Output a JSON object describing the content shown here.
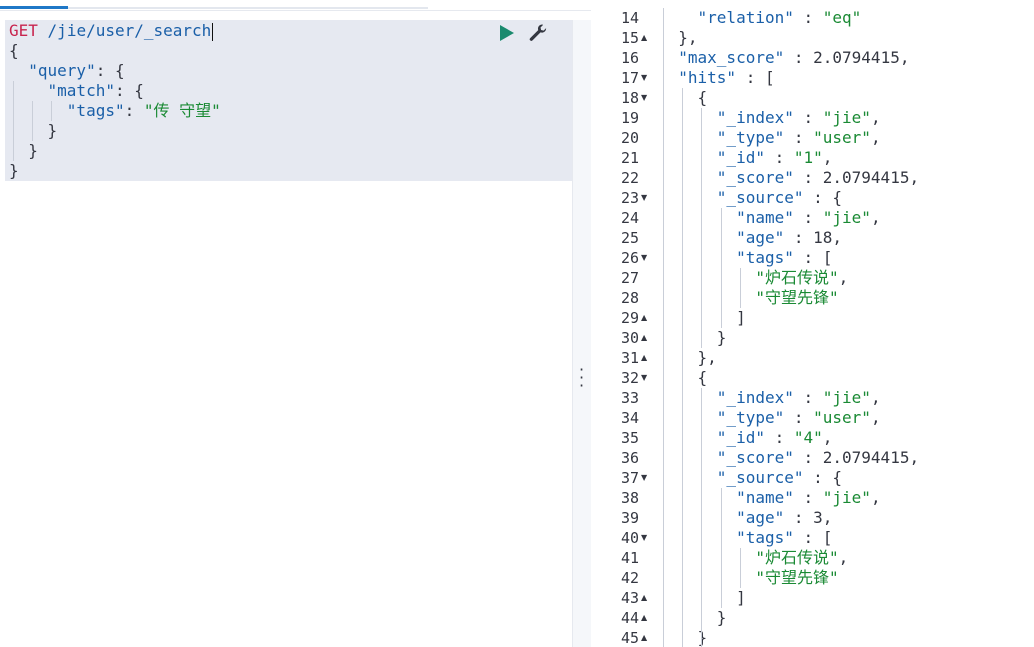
{
  "request": {
    "method": "GET",
    "path": "/jie/user/_search",
    "body_lines": [
      {
        "indent": 0,
        "parts": [
          {
            "t": "{",
            "c": "punct"
          }
        ]
      },
      {
        "indent": 1,
        "parts": [
          {
            "t": "\"query\"",
            "c": "key"
          },
          {
            "t": ": {",
            "c": "punct"
          }
        ]
      },
      {
        "indent": 2,
        "parts": [
          {
            "t": "\"match\"",
            "c": "key"
          },
          {
            "t": ": {",
            "c": "punct"
          }
        ]
      },
      {
        "indent": 3,
        "parts": [
          {
            "t": "\"tags\"",
            "c": "key"
          },
          {
            "t": ": ",
            "c": "punct"
          },
          {
            "t": "\"传 守望\"",
            "c": "str"
          }
        ]
      },
      {
        "indent": 2,
        "parts": [
          {
            "t": "}",
            "c": "punct"
          }
        ]
      },
      {
        "indent": 1,
        "parts": [
          {
            "t": "}",
            "c": "punct"
          }
        ]
      },
      {
        "indent": 0,
        "parts": [
          {
            "t": "}",
            "c": "punct"
          }
        ]
      }
    ]
  },
  "icons": {
    "run": "play-triangle-icon",
    "settings": "wrench-icon",
    "divider": "vertical-ellipsis-icon"
  },
  "colors": {
    "method": "#c8244e",
    "key": "#1a5fa8",
    "string": "#1a8a34",
    "run": "#1a8a6e",
    "tab_active": "#1f78c7"
  },
  "response": {
    "lines": [
      {
        "n": "14",
        "fold": "",
        "indent": 2,
        "parts": [
          {
            "t": "\"relation\"",
            "c": "key"
          },
          {
            "t": " : ",
            "c": "punct"
          },
          {
            "t": "\"eq\"",
            "c": "str"
          }
        ]
      },
      {
        "n": "15",
        "fold": "▲",
        "indent": 1,
        "parts": [
          {
            "t": "},",
            "c": "punct"
          }
        ]
      },
      {
        "n": "16",
        "fold": "",
        "indent": 1,
        "parts": [
          {
            "t": "\"max_score\"",
            "c": "key"
          },
          {
            "t": " : 2.0794415,",
            "c": "punct"
          }
        ]
      },
      {
        "n": "17",
        "fold": "▼",
        "indent": 1,
        "parts": [
          {
            "t": "\"hits\"",
            "c": "key"
          },
          {
            "t": " : [",
            "c": "punct"
          }
        ]
      },
      {
        "n": "18",
        "fold": "▼",
        "indent": 2,
        "parts": [
          {
            "t": "{",
            "c": "punct"
          }
        ]
      },
      {
        "n": "19",
        "fold": "",
        "indent": 3,
        "parts": [
          {
            "t": "\"_index\"",
            "c": "key"
          },
          {
            "t": " : ",
            "c": "punct"
          },
          {
            "t": "\"jie\"",
            "c": "str"
          },
          {
            "t": ",",
            "c": "punct"
          }
        ]
      },
      {
        "n": "20",
        "fold": "",
        "indent": 3,
        "parts": [
          {
            "t": "\"_type\"",
            "c": "key"
          },
          {
            "t": " : ",
            "c": "punct"
          },
          {
            "t": "\"user\"",
            "c": "str"
          },
          {
            "t": ",",
            "c": "punct"
          }
        ]
      },
      {
        "n": "21",
        "fold": "",
        "indent": 3,
        "parts": [
          {
            "t": "\"_id\"",
            "c": "key"
          },
          {
            "t": " : ",
            "c": "punct"
          },
          {
            "t": "\"1\"",
            "c": "str"
          },
          {
            "t": ",",
            "c": "punct"
          }
        ]
      },
      {
        "n": "22",
        "fold": "",
        "indent": 3,
        "parts": [
          {
            "t": "\"_score\"",
            "c": "key"
          },
          {
            "t": " : 2.0794415,",
            "c": "punct"
          }
        ]
      },
      {
        "n": "23",
        "fold": "▼",
        "indent": 3,
        "parts": [
          {
            "t": "\"_source\"",
            "c": "key"
          },
          {
            "t": " : {",
            "c": "punct"
          }
        ]
      },
      {
        "n": "24",
        "fold": "",
        "indent": 4,
        "parts": [
          {
            "t": "\"name\"",
            "c": "key"
          },
          {
            "t": " : ",
            "c": "punct"
          },
          {
            "t": "\"jie\"",
            "c": "str"
          },
          {
            "t": ",",
            "c": "punct"
          }
        ]
      },
      {
        "n": "25",
        "fold": "",
        "indent": 4,
        "parts": [
          {
            "t": "\"age\"",
            "c": "key"
          },
          {
            "t": " : 18,",
            "c": "punct"
          }
        ]
      },
      {
        "n": "26",
        "fold": "▼",
        "indent": 4,
        "parts": [
          {
            "t": "\"tags\"",
            "c": "key"
          },
          {
            "t": " : [",
            "c": "punct"
          }
        ]
      },
      {
        "n": "27",
        "fold": "",
        "indent": 5,
        "parts": [
          {
            "t": "\"炉石传说\"",
            "c": "str"
          },
          {
            "t": ",",
            "c": "punct"
          }
        ]
      },
      {
        "n": "28",
        "fold": "",
        "indent": 5,
        "parts": [
          {
            "t": "\"守望先锋\"",
            "c": "str"
          }
        ]
      },
      {
        "n": "29",
        "fold": "▲",
        "indent": 4,
        "parts": [
          {
            "t": "]",
            "c": "punct"
          }
        ]
      },
      {
        "n": "30",
        "fold": "▲",
        "indent": 3,
        "parts": [
          {
            "t": "}",
            "c": "punct"
          }
        ]
      },
      {
        "n": "31",
        "fold": "▲",
        "indent": 2,
        "parts": [
          {
            "t": "},",
            "c": "punct"
          }
        ]
      },
      {
        "n": "32",
        "fold": "▼",
        "indent": 2,
        "parts": [
          {
            "t": "{",
            "c": "punct"
          }
        ]
      },
      {
        "n": "33",
        "fold": "",
        "indent": 3,
        "parts": [
          {
            "t": "\"_index\"",
            "c": "key"
          },
          {
            "t": " : ",
            "c": "punct"
          },
          {
            "t": "\"jie\"",
            "c": "str"
          },
          {
            "t": ",",
            "c": "punct"
          }
        ]
      },
      {
        "n": "34",
        "fold": "",
        "indent": 3,
        "parts": [
          {
            "t": "\"_type\"",
            "c": "key"
          },
          {
            "t": " : ",
            "c": "punct"
          },
          {
            "t": "\"user\"",
            "c": "str"
          },
          {
            "t": ",",
            "c": "punct"
          }
        ]
      },
      {
        "n": "35",
        "fold": "",
        "indent": 3,
        "parts": [
          {
            "t": "\"_id\"",
            "c": "key"
          },
          {
            "t": " : ",
            "c": "punct"
          },
          {
            "t": "\"4\"",
            "c": "str"
          },
          {
            "t": ",",
            "c": "punct"
          }
        ]
      },
      {
        "n": "36",
        "fold": "",
        "indent": 3,
        "parts": [
          {
            "t": "\"_score\"",
            "c": "key"
          },
          {
            "t": " : 2.0794415,",
            "c": "punct"
          }
        ]
      },
      {
        "n": "37",
        "fold": "▼",
        "indent": 3,
        "parts": [
          {
            "t": "\"_source\"",
            "c": "key"
          },
          {
            "t": " : {",
            "c": "punct"
          }
        ]
      },
      {
        "n": "38",
        "fold": "",
        "indent": 4,
        "parts": [
          {
            "t": "\"name\"",
            "c": "key"
          },
          {
            "t": " : ",
            "c": "punct"
          },
          {
            "t": "\"jie\"",
            "c": "str"
          },
          {
            "t": ",",
            "c": "punct"
          }
        ]
      },
      {
        "n": "39",
        "fold": "",
        "indent": 4,
        "parts": [
          {
            "t": "\"age\"",
            "c": "key"
          },
          {
            "t": " : 3,",
            "c": "punct"
          }
        ]
      },
      {
        "n": "40",
        "fold": "▼",
        "indent": 4,
        "parts": [
          {
            "t": "\"tags\"",
            "c": "key"
          },
          {
            "t": " : [",
            "c": "punct"
          }
        ]
      },
      {
        "n": "41",
        "fold": "",
        "indent": 5,
        "parts": [
          {
            "t": "\"炉石传说\"",
            "c": "str"
          },
          {
            "t": ",",
            "c": "punct"
          }
        ]
      },
      {
        "n": "42",
        "fold": "",
        "indent": 5,
        "parts": [
          {
            "t": "\"守望先锋\"",
            "c": "str"
          }
        ]
      },
      {
        "n": "43",
        "fold": "▲",
        "indent": 4,
        "parts": [
          {
            "t": "]",
            "c": "punct"
          }
        ]
      },
      {
        "n": "44",
        "fold": "▲",
        "indent": 3,
        "parts": [
          {
            "t": "}",
            "c": "punct"
          }
        ]
      },
      {
        "n": "45",
        "fold": "▲",
        "indent": 2,
        "parts": [
          {
            "t": "}",
            "c": "punct"
          }
        ]
      }
    ]
  }
}
